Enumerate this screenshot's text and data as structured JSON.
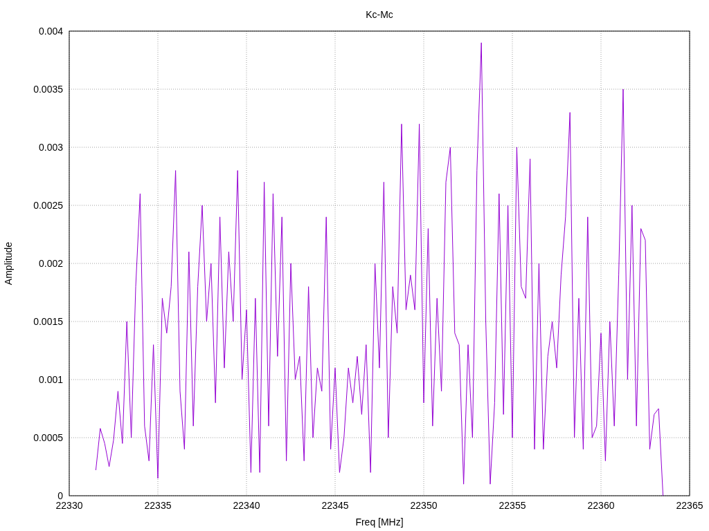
{
  "chart_data": {
    "type": "line",
    "title": "Kc-Mc",
    "xlabel": "Freq [MHz]",
    "ylabel": "Amplitude",
    "xlim": [
      22330,
      22365
    ],
    "ylim": [
      0,
      0.004
    ],
    "xticks": [
      22330,
      22335,
      22340,
      22345,
      22350,
      22355,
      22360,
      22365
    ],
    "yticks": [
      {
        "value": 0,
        "label": "0"
      },
      {
        "value": 0.0005,
        "label": "0.0005"
      },
      {
        "value": 0.001,
        "label": "0.001"
      },
      {
        "value": 0.0015,
        "label": "0.0015"
      },
      {
        "value": 0.002,
        "label": "0.002"
      },
      {
        "value": 0.0025,
        "label": "0.0025"
      },
      {
        "value": 0.003,
        "label": "0.003"
      },
      {
        "value": 0.0035,
        "label": "0.0035"
      },
      {
        "value": 0.004,
        "label": "0.004"
      }
    ],
    "x": [
      22331.5,
      22331.75,
      22332,
      22332.25,
      22332.5,
      22332.75,
      22333,
      22333.25,
      22333.5,
      22333.75,
      22334,
      22334.25,
      22334.5,
      22334.75,
      22335,
      22335.25,
      22335.5,
      22335.75,
      22336,
      22336.25,
      22336.5,
      22336.75,
      22337,
      22337.25,
      22337.5,
      22337.75,
      22338,
      22338.25,
      22338.5,
      22338.75,
      22339,
      22339.25,
      22339.5,
      22339.75,
      22340,
      22340.25,
      22340.5,
      22340.75,
      22341,
      22341.25,
      22341.5,
      22341.75,
      22342,
      22342.25,
      22342.5,
      22342.75,
      22343,
      22343.25,
      22343.5,
      22343.75,
      22344,
      22344.25,
      22344.5,
      22344.75,
      22345,
      22345.25,
      22345.5,
      22345.75,
      22346,
      22346.25,
      22346.5,
      22346.75,
      22347,
      22347.25,
      22347.5,
      22347.75,
      22348,
      22348.25,
      22348.5,
      22348.75,
      22349,
      22349.25,
      22349.5,
      22349.75,
      22350,
      22350.25,
      22350.5,
      22350.75,
      22351,
      22351.25,
      22351.5,
      22351.75,
      22352,
      22352.25,
      22352.5,
      22352.75,
      22353,
      22353.25,
      22353.5,
      22353.75,
      22354,
      22354.25,
      22354.5,
      22354.75,
      22355,
      22355.25,
      22355.5,
      22355.75,
      22356,
      22356.25,
      22356.5,
      22356.75,
      22357,
      22357.25,
      22357.5,
      22357.75,
      22358,
      22358.25,
      22358.5,
      22358.75,
      22359,
      22359.25,
      22359.5,
      22359.75,
      22360,
      22360.25,
      22360.5,
      22360.75,
      22361,
      22361.25,
      22361.5,
      22361.75,
      22362,
      22362.25,
      22362.5,
      22362.75,
      22363,
      22363.25,
      22363.5
    ],
    "grid": true,
    "series": [
      {
        "color": "#9400d3",
        "values": [
          0.00022,
          0.00058,
          0.00045,
          0.00025,
          0.00048,
          0.0009,
          0.00045,
          0.0015,
          0.0005,
          0.0018,
          0.0026,
          0.0006,
          0.0003,
          0.0013,
          0.00015,
          0.0017,
          0.0014,
          0.0018,
          0.0028,
          0.0009,
          0.0004,
          0.0021,
          0.0006,
          0.0018,
          0.0025,
          0.0015,
          0.002,
          0.0008,
          0.0024,
          0.0011,
          0.0021,
          0.0015,
          0.0028,
          0.001,
          0.0016,
          0.0002,
          0.0017,
          0.0002,
          0.0027,
          0.0006,
          0.0026,
          0.0012,
          0.0024,
          0.0003,
          0.002,
          0.001,
          0.0012,
          0.0003,
          0.0018,
          0.0005,
          0.0011,
          0.0009,
          0.0024,
          0.0004,
          0.0011,
          0.0002,
          0.0005,
          0.0011,
          0.0008,
          0.0012,
          0.0007,
          0.0013,
          0.0002,
          0.002,
          0.0011,
          0.0027,
          0.0005,
          0.0018,
          0.0014,
          0.0032,
          0.0016,
          0.0019,
          0.0016,
          0.0032,
          0.0008,
          0.0023,
          0.0006,
          0.0017,
          0.0009,
          0.0027,
          0.003,
          0.0014,
          0.0013,
          0.0001,
          0.0013,
          0.0005,
          0.0028,
          0.0039,
          0.0015,
          0.0001,
          0.0008,
          0.0026,
          0.0007,
          0.0025,
          0.0005,
          0.003,
          0.0018,
          0.0017,
          0.0029,
          0.0004,
          0.002,
          0.0004,
          0.0012,
          0.0015,
          0.0011,
          0.0019,
          0.0024,
          0.0033,
          0.0005,
          0.0017,
          0.0004,
          0.0024,
          0.0005,
          0.0006,
          0.0014,
          0.0003,
          0.0015,
          0.0006,
          0.0019,
          0.0035,
          0.001,
          0.0025,
          0.0006,
          0.0023,
          0.0022,
          0.0004,
          0.0007,
          0.00075,
          0
        ]
      }
    ]
  }
}
